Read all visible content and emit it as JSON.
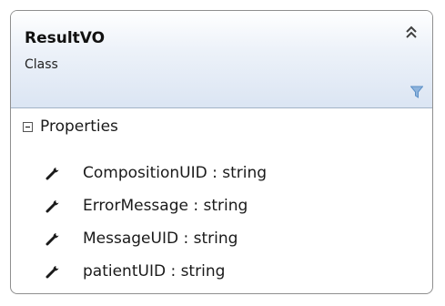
{
  "class_shape": {
    "name": "ResultVO",
    "kind": "Class",
    "icons": {
      "collapse": "double-chevron-up-icon",
      "filter": "funnel-icon",
      "section_expander": "minus-box-icon",
      "member": "wrench-icon"
    },
    "colors": {
      "border": "#8f8f8f",
      "header_gradient_top": "#ffffff",
      "header_gradient_bottom": "#dbe5f3",
      "filter_icon": "#5b8fc6"
    },
    "sections": [
      {
        "title": "Properties",
        "expanded": true,
        "items": [
          {
            "label": "CompositionUID : string"
          },
          {
            "label": "ErrorMessage : string"
          },
          {
            "label": "MessageUID : string"
          },
          {
            "label": "patientUID : string"
          }
        ]
      }
    ]
  }
}
